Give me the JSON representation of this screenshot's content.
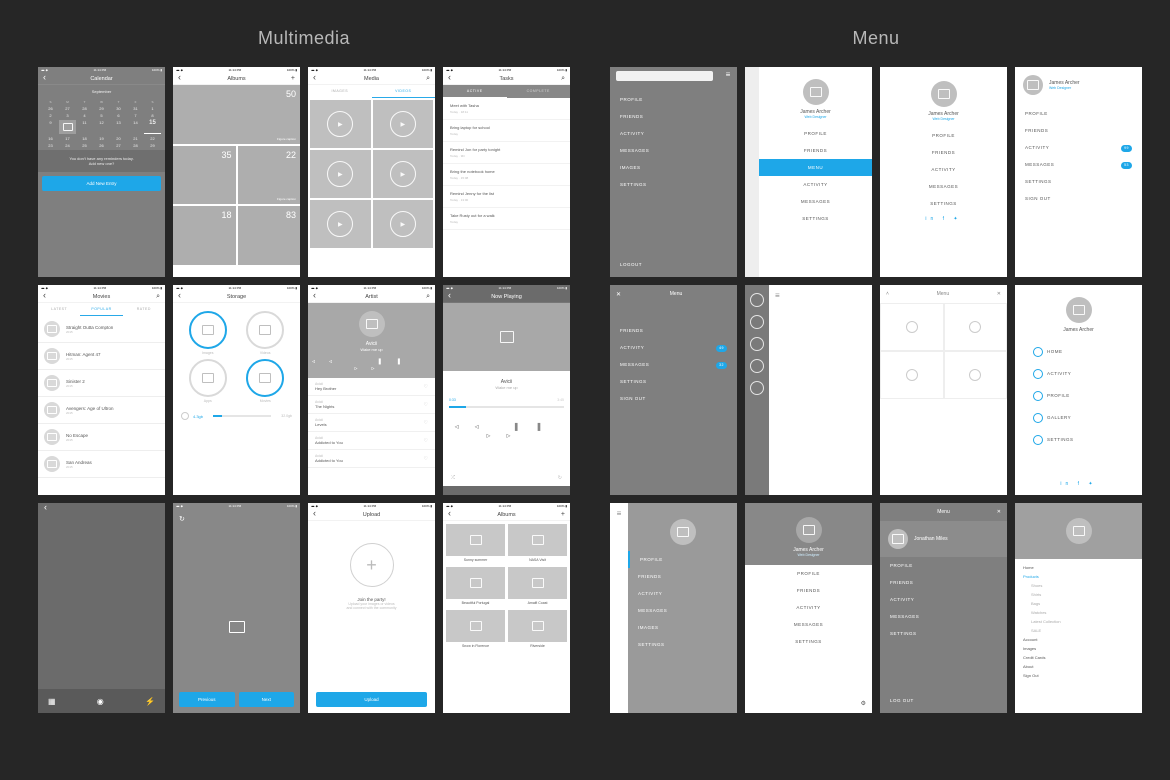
{
  "sections": {
    "multimedia": "Multimedia",
    "menu": "Menu"
  },
  "statusbar": {
    "time": "11:14 PM",
    "pct": "100%"
  },
  "calendar": {
    "title": "Calendar",
    "month": "September",
    "dow": [
      "S",
      "M",
      "T",
      "W",
      "T",
      "F",
      "S"
    ],
    "today": "15",
    "note1": "You don't have any reminders today.",
    "note2": "Add new one?",
    "add_btn": "Add New Entry"
  },
  "albums_counts": {
    "title": "Albums",
    "cells": [
      {
        "num": "50",
        "cap": "Figure caption"
      },
      {
        "num": "",
        "cap": ""
      },
      {
        "num": "35",
        "cap": ""
      },
      {
        "num": "22",
        "cap": "Figure caption"
      },
      {
        "num": "18",
        "cap": ""
      },
      {
        "num": "83",
        "cap": ""
      }
    ]
  },
  "media": {
    "title": "Media",
    "tabs": [
      "IMAGES",
      "VIDEOS"
    ]
  },
  "tasks": {
    "title": "Tasks",
    "tabs": [
      "ACTIVE",
      "COMPLETE"
    ],
    "items": [
      {
        "t": "Meet with Tasha",
        "s1": "Today",
        "s2": "18:11"
      },
      {
        "t": "Bring laptop for school",
        "s1": "Today",
        "s2": ""
      },
      {
        "t": "Remind Jon for party tonight",
        "s1": "Today",
        "s2": "9hr"
      },
      {
        "t": "Bring the notebook home",
        "s1": "Today",
        "s2": "15:08"
      },
      {
        "t": "Remind Jenny for the list",
        "s1": "Today",
        "s2": "13:00"
      },
      {
        "t": "Take Rusty out for a walk",
        "s1": "Today",
        "s2": ""
      }
    ]
  },
  "movies": {
    "title": "Movies",
    "tabs": [
      "LATEST",
      "POPULAR",
      "RATED"
    ],
    "list": [
      {
        "t": "Straight Outta Compton",
        "y": "2015"
      },
      {
        "t": "Hitman: Agent 47",
        "y": "2015"
      },
      {
        "t": "Sinister 2",
        "y": "2015"
      },
      {
        "t": "Avengers: Age of Ultron",
        "y": "2015"
      },
      {
        "t": "No Escape",
        "y": "2015"
      },
      {
        "t": "San Andreas",
        "y": "2015"
      }
    ]
  },
  "storage": {
    "title": "Storage",
    "labels": [
      "Images",
      "Videos",
      "Apps",
      "Movies"
    ],
    "used": "4.3gb",
    "total": "32.0gb"
  },
  "artist": {
    "title": "Artist",
    "name": "Avicii",
    "track": "Wake me up",
    "songs": [
      {
        "a": "Avicii",
        "t": "Hey Brother"
      },
      {
        "a": "Avicii",
        "t": "The Nights"
      },
      {
        "a": "Avicii",
        "t": "Levels"
      },
      {
        "a": "Avicii",
        "t": "Addicted to You"
      },
      {
        "a": "Avicii",
        "t": "Addicted to You"
      }
    ]
  },
  "nowplaying": {
    "title": "Now Playing",
    "artist": "Avicii",
    "track": "Wake me up",
    "t1": "0:33",
    "t2": "3:45"
  },
  "upload": {
    "title": "Upload",
    "heading": "Join the party!",
    "sub1": "Upload your images or videos",
    "sub2": "and connect with the community",
    "btn": "Upload"
  },
  "albums_named": {
    "title": "Albums",
    "items": [
      "Sunny summer",
      "NASA Visit",
      "Beautiful Portugal",
      "Amalfi Coast",
      "Snow in Florence",
      "Riverside"
    ]
  },
  "pager": {
    "prev": "Previous",
    "next": "Next"
  },
  "menu_items_caps": [
    "PROFILE",
    "FRIENDS",
    "ACTIVITY",
    "MESSAGES",
    "IMAGES",
    "SETTINGS"
  ],
  "logout": "LOGOUT",
  "logout2": "LOG OUT",
  "signout": "SIGN OUT",
  "profile": {
    "name": "James Archer",
    "role": "Web Designer"
  },
  "profile2": {
    "name": "Jonathan Miles"
  },
  "menu_items_mixed": [
    "PROFILE",
    "FRIENDS",
    "MENU",
    "ACTIVITY",
    "MESSAGES",
    "SETTINGS"
  ],
  "menu_items_lower": [
    "PROFILE",
    "FRIENDS",
    "ACTIVITY",
    "MESSAGES",
    "SETTINGS"
  ],
  "menu_items_dark2": [
    "FRIENDS",
    "ACTIVITY",
    "MESSAGES",
    "SETTINGS",
    "SIGN OUT"
  ],
  "badges": {
    "activity": "49",
    "messages": "32"
  },
  "badges2": {
    "activity": "99",
    "messages": "53"
  },
  "menu_title": "Menu",
  "icon_menu": [
    {
      "label": "HOME"
    },
    {
      "label": "ACTIVITY"
    },
    {
      "label": "PROFILE"
    },
    {
      "label": "GALLERY"
    },
    {
      "label": "SETTINGS"
    }
  ],
  "tree_menu": {
    "items": [
      "Home",
      "Products",
      "Account",
      "Images",
      "Credit Cards",
      "About",
      "Sign Out"
    ],
    "sub": [
      "Shoes",
      "Shirts",
      "Bags",
      "Watches",
      "Latest Collection",
      "SALE"
    ]
  },
  "menu_profile_left": [
    "PROFILE",
    "FRIENDS",
    "ACTIVITY",
    "MESSAGES",
    "IMAGES",
    "SETTINGS"
  ],
  "menu_dark3": [
    "PROFILE",
    "FRIENDS",
    "ACTIVITY",
    "MESSAGES",
    "SETTINGS"
  ]
}
